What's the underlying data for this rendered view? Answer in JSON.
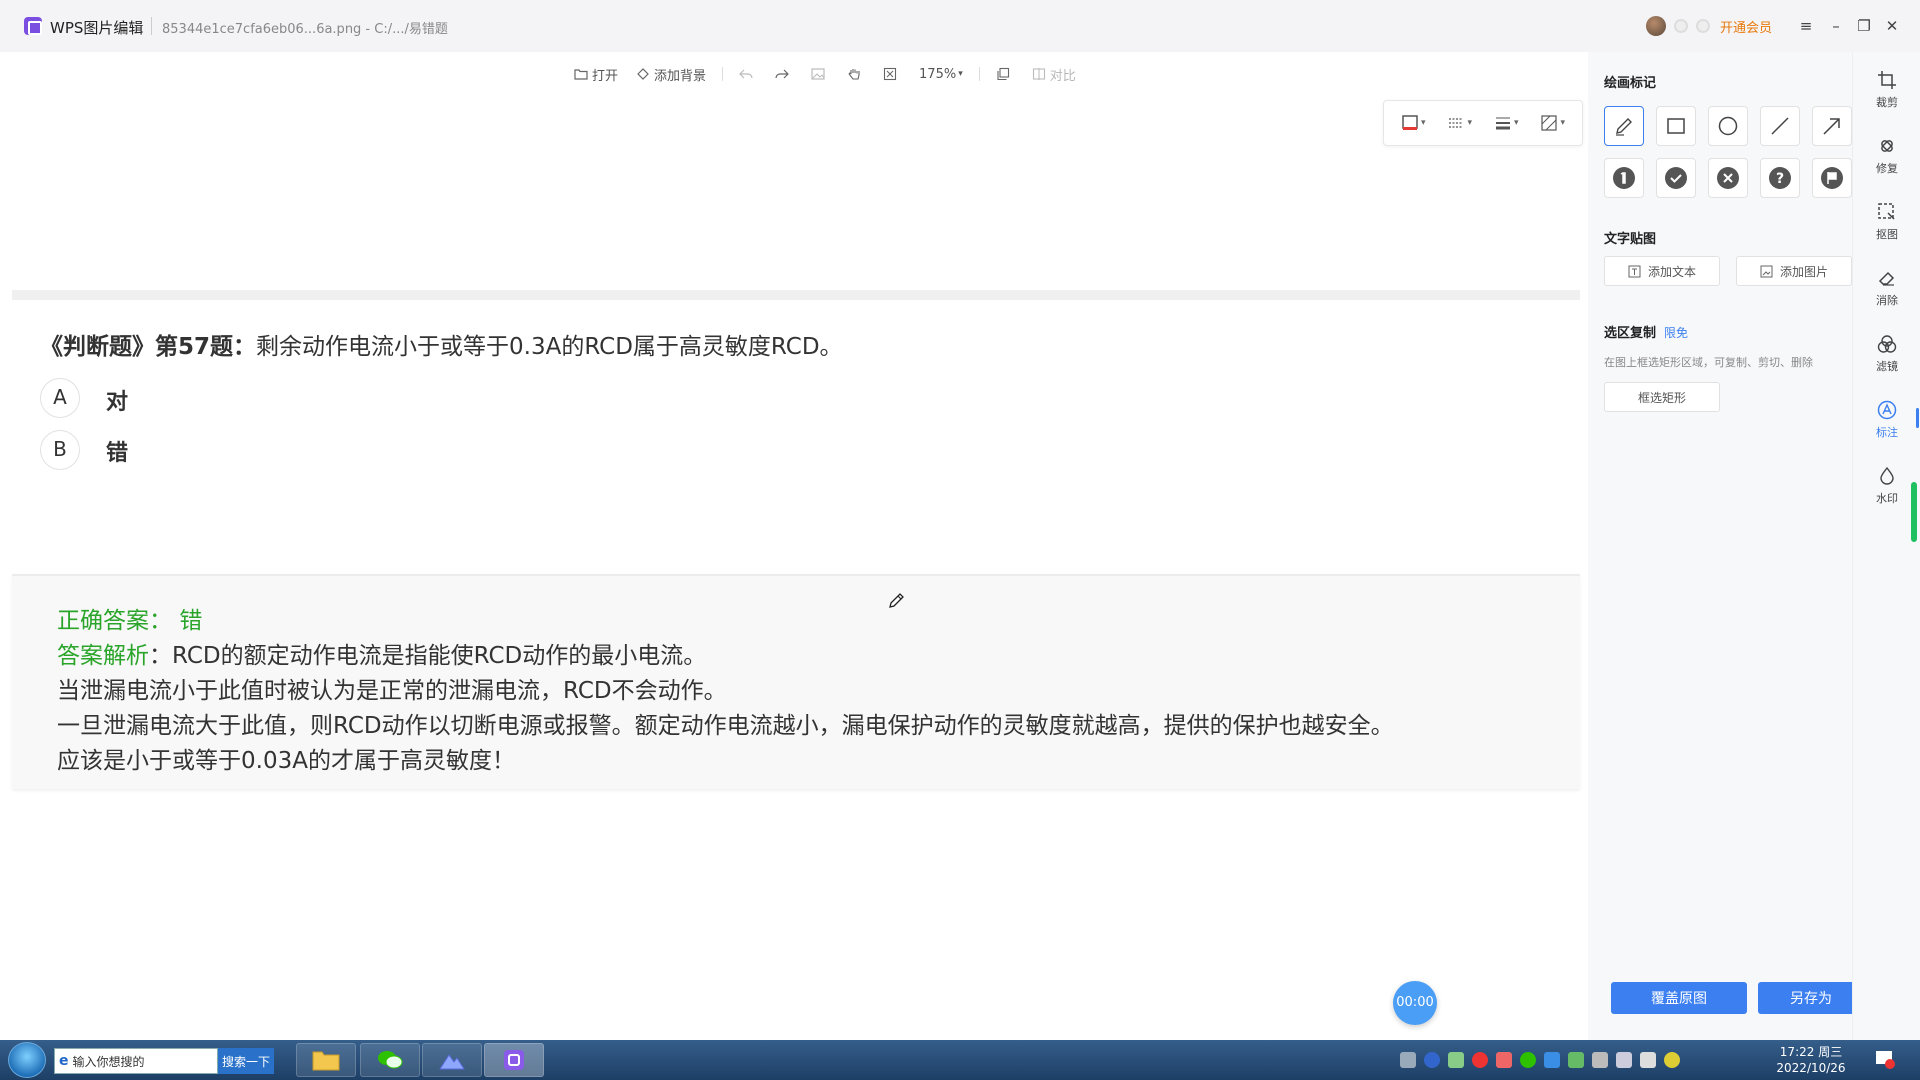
{
  "titlebar": {
    "app_title": "WPS图片编辑",
    "file_title": "85344e1ce7cfa6eb06...6a.png - C:/.../易错题",
    "vip_label": "开通会员"
  },
  "toolbar": {
    "open": "打开",
    "add_background": "添加背景",
    "zoom": "175%",
    "compare": "对比"
  },
  "question": {
    "prefix": "《判断题》第57题：",
    "text": "剩余动作电流小于或等于0.3A的RCD属于高灵敏度RCD。",
    "options": [
      {
        "letter": "A",
        "text": "对"
      },
      {
        "letter": "B",
        "text": "错"
      }
    ]
  },
  "answer": {
    "correct_label": "正确答案：",
    "correct_value": "错",
    "analysis_label": "答案解析",
    "lines": [
      "：RCD的额定动作电流是指能使RCD动作的最小电流。",
      "当泄漏电流小于此值时被认为是正常的泄漏电流，RCD不会动作。",
      "一旦泄漏电流大于此值，则RCD动作以切断电源或报警。额定动作电流越小，漏电保护动作的灵敏度就越高，提供的保护也越安全。",
      "应该是小于或等于0.03A的才属于高灵敏度！"
    ]
  },
  "timer": "00:00",
  "panel": {
    "drawing_title": "绘画标记",
    "text_sticker_title": "文字贴图",
    "add_text": "添加文本",
    "add_image": "添加图片",
    "select_copy_title": "选区复制",
    "limited_free": "限免",
    "select_copy_desc": "在图上框选矩形区域，可复制、剪切、删除",
    "select_rect": "框选矩形",
    "overwrite_original": "覆盖原图",
    "save_as": "另存为"
  },
  "rail": {
    "items": [
      "裁剪",
      "修复",
      "抠图",
      "消除",
      "滤镜",
      "标注",
      "水印"
    ]
  },
  "taskbar": {
    "search_placeholder": "输入你想搜的",
    "search_button": "搜索一下",
    "time": "17:22 周三",
    "date": "2022/10/26"
  },
  "colors": {
    "accent": "#3b7ff0",
    "answer_green": "#2aa52a",
    "vip_orange": "#e8790b"
  }
}
